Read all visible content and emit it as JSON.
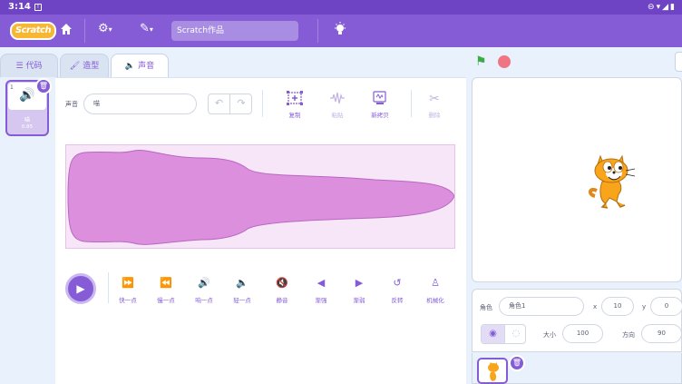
{
  "status_bar": {
    "time": "3:14",
    "notification_icon": "notification-icon",
    "right_icons": [
      "do-not-disturb-icon",
      "wifi-icon",
      "signal-icon",
      "battery-icon"
    ]
  },
  "menubar": {
    "logo": "Scratch",
    "project_title": "Scratch作品",
    "icons": [
      "home-icon",
      "settings-icon",
      "edit-icon",
      "theme-icon"
    ]
  },
  "tabs": [
    {
      "label": "代码",
      "icon": "code-icon",
      "active": false
    },
    {
      "label": "造型",
      "icon": "costume-icon",
      "active": false
    },
    {
      "label": "声音",
      "icon": "sound-icon",
      "active": true
    }
  ],
  "sound_list": [
    {
      "index": "1",
      "name": "喵",
      "duration": "0.85"
    }
  ],
  "editor": {
    "sound_label": "声音",
    "sound_name": "喵",
    "tools": [
      {
        "label": "复制",
        "icon": "copy-icon",
        "enabled": true
      },
      {
        "label": "粘贴",
        "icon": "paste-icon",
        "enabled": false
      },
      {
        "label": "新拷贝",
        "icon": "copy-new-icon",
        "enabled": true
      },
      {
        "label": "删除",
        "icon": "cut-icon",
        "enabled": false
      }
    ],
    "effects": [
      {
        "label": "快一点",
        "icon": "faster-icon"
      },
      {
        "label": "慢一点",
        "icon": "slower-icon"
      },
      {
        "label": "响一点",
        "icon": "louder-icon"
      },
      {
        "label": "轻一点",
        "icon": "softer-icon"
      },
      {
        "label": "静音",
        "icon": "mute-icon"
      },
      {
        "label": "渐强",
        "icon": "fade-in-icon"
      },
      {
        "label": "渐弱",
        "icon": "fade-out-icon"
      },
      {
        "label": "反转",
        "icon": "reverse-icon"
      },
      {
        "label": "机械化",
        "icon": "robot-icon"
      }
    ]
  },
  "sprite_info": {
    "sprite_label": "角色",
    "sprite_name": "角色1",
    "x_label": "x",
    "x_value": "10",
    "y_label": "y",
    "y_value": "0",
    "size_label": "大小",
    "size_value": "100",
    "direction_label": "方向",
    "direction_value": "90"
  },
  "colors": {
    "brand": "#855cd6",
    "status_bar": "#6f44c4",
    "waveform": "#d98fdb",
    "flag": "#3daa45",
    "stop": "#f07582"
  }
}
